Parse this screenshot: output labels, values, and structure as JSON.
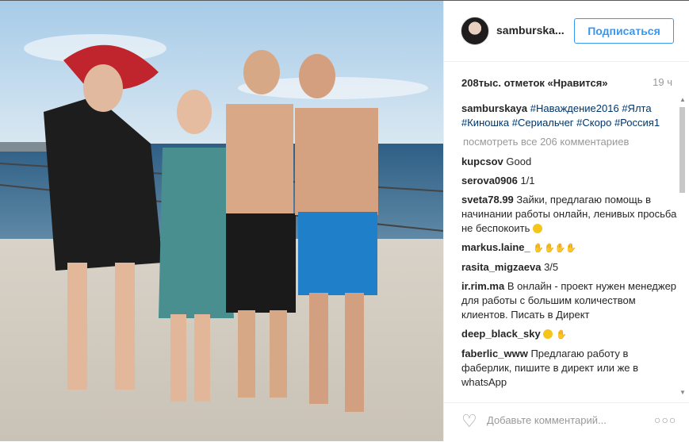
{
  "header": {
    "username": "samburska...",
    "follow_label": "Подписаться"
  },
  "likes": {
    "count": "208тыс. отметок «Нравится»",
    "time": "19 ч"
  },
  "caption": {
    "username": "samburskaya",
    "tags": [
      "#Наваждение2016",
      "#Ялта",
      "#Киношка",
      "#Сериальчег",
      "#Скоро",
      "#Россия1"
    ]
  },
  "view_all": "посмотреть все 206 комментариев",
  "comments": [
    {
      "user": "kupcsov",
      "text": "Good"
    },
    {
      "user": "serova0906",
      "text": "1/1"
    },
    {
      "user": "sveta78.99",
      "text": "Зайки, предлагаю помощь в начинании работы онлайн, ленивых просьба не беспокоить"
    },
    {
      "user": "markus.laine_",
      "text": ""
    },
    {
      "user": "rasita_migzaeva",
      "text": "3/5"
    },
    {
      "user": "ir.rim.ma",
      "text": "В онлайн - проект нужен менеджер для работы с большим количеством клиентов. Писать в Директ"
    },
    {
      "user": "deep_black_sky",
      "text": ""
    },
    {
      "user": "faberlic_www",
      "text": "Предлагаю работу в фаберлик, пишите в директ или же в whatsApp"
    }
  ],
  "footer": {
    "placeholder": "Добавьте комментарий..."
  },
  "icons": {
    "heart": "heart-icon",
    "more": "more-options-icon"
  }
}
